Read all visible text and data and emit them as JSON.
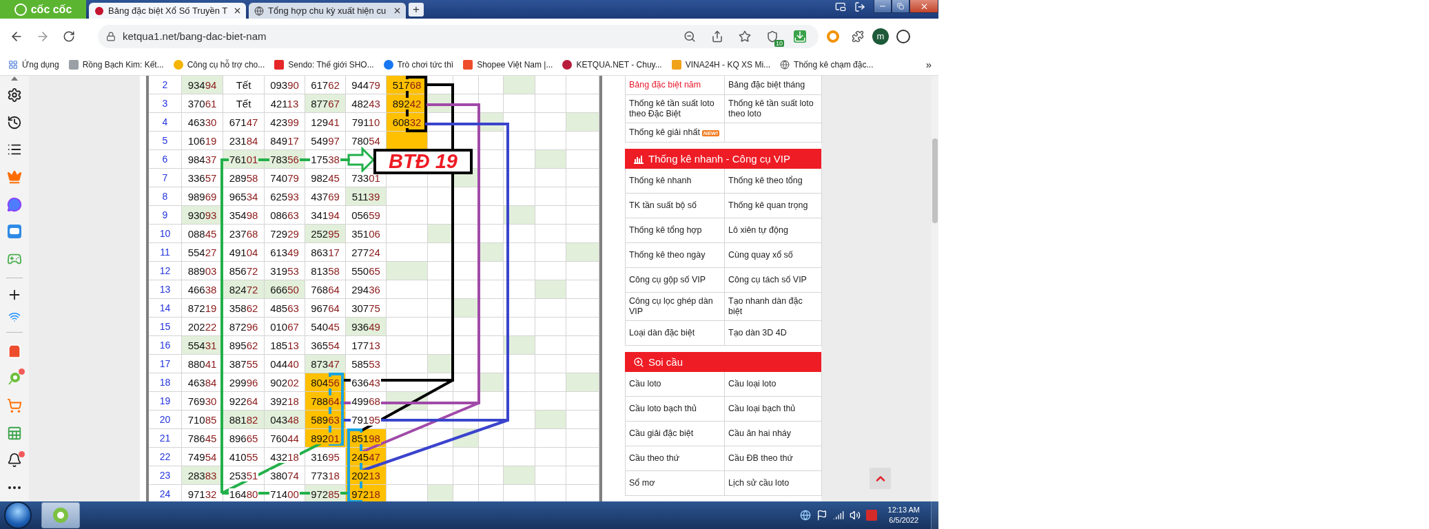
{
  "browser": {
    "logo": "cốc cốc",
    "tabs": [
      {
        "title": "Bảng đặc biệt Xổ Số Truyền T",
        "selected": true
      },
      {
        "title": "Tổng hợp chu kỳ xuất hiện cu",
        "selected": false
      }
    ],
    "new_tab": "+",
    "url": "ketqua1.net/bang-dac-biet-nam",
    "shield_badge": "10",
    "profile_initial": "m",
    "bookmarks": [
      {
        "label": "Ứng dụng",
        "kind": "apps"
      },
      {
        "label": "Rồng Bạch Kim: Kết...",
        "kind": "rbk"
      },
      {
        "label": "Công cụ hỗ trợ cho...",
        "kind": "tool"
      },
      {
        "label": "Sendo: Thế giới SHO...",
        "kind": "sendo"
      },
      {
        "label": "Trò chơi tức thì",
        "kind": "facebook"
      },
      {
        "label": "Shopee Việt Nam |...",
        "kind": "shopee"
      },
      {
        "label": "KETQUA.NET - Chuy...",
        "kind": "ketqua"
      },
      {
        "label": "VINA24H - KQ XS Mi...",
        "kind": "vina"
      },
      {
        "label": "Thống kê chạm đặc...",
        "kind": "globe"
      }
    ],
    "bookmarks_more": "»"
  },
  "side_rail": [
    {
      "kind": "caret",
      "badge": false
    },
    {
      "kind": "settings",
      "badge": false
    },
    {
      "kind": "history",
      "badge": false
    },
    {
      "kind": "list",
      "badge": false
    },
    {
      "kind": "crown",
      "badge": false
    },
    {
      "kind": "messenger",
      "badge": false
    },
    {
      "kind": "zalo",
      "badge": false
    },
    {
      "kind": "gamepad",
      "badge": false
    },
    {
      "kind": "divider"
    },
    {
      "kind": "plus",
      "badge": false
    },
    {
      "kind": "download",
      "badge": false
    },
    {
      "kind": "divider"
    },
    {
      "kind": "shop",
      "badge": false
    },
    {
      "kind": "ball",
      "badge": true
    },
    {
      "kind": "cart",
      "badge": false
    },
    {
      "kind": "sheet",
      "badge": false
    },
    {
      "kind": "bell",
      "badge": true
    },
    {
      "kind": "more",
      "badge": false
    }
  ],
  "table": {
    "rows": [
      {
        "num": "2",
        "cells": [
          {
            "head": "934",
            "tail": "94",
            "color": "#e2efda"
          },
          {
            "head": "Tết"
          },
          {
            "head": "093",
            "tail": "90"
          },
          {
            "head": "617",
            "tail": "62"
          },
          {
            "head": "944",
            "tail": "79"
          },
          {
            "head": "517",
            "tail": "68",
            "color": "#ffc000"
          },
          {},
          {},
          {},
          {
            "color": "#e2efda"
          },
          {},
          {}
        ]
      },
      {
        "num": "3",
        "cells": [
          {
            "head": "370",
            "tail": "61"
          },
          {
            "head": "Tết"
          },
          {
            "head": "421",
            "tail": "13"
          },
          {
            "head": "877",
            "tail": "67",
            "color": "#e2efda"
          },
          {
            "head": "482",
            "tail": "43"
          },
          {
            "head": "892",
            "tail": "42",
            "color": "#ffc000"
          },
          {
            "color": "#e2efda"
          },
          {},
          {},
          {},
          {},
          {}
        ]
      },
      {
        "num": "4",
        "cells": [
          {
            "head": "463",
            "tail": "30"
          },
          {
            "head": "671",
            "tail": "47"
          },
          {
            "head": "423",
            "tail": "99"
          },
          {
            "head": "129",
            "tail": "41"
          },
          {
            "head": "791",
            "tail": "10"
          },
          {
            "head": "608",
            "tail": "32",
            "color": "#ffc000"
          },
          {},
          {},
          {
            "color": "#e2efda"
          },
          {},
          {},
          {
            "color": "#e2efda"
          }
        ]
      },
      {
        "num": "5",
        "cells": [
          {
            "head": "106",
            "tail": "19"
          },
          {
            "head": "231",
            "tail": "84"
          },
          {
            "head": "849",
            "tail": "17"
          },
          {
            "head": "549",
            "tail": "97"
          },
          {
            "head": "780",
            "tail": "54"
          },
          {
            "color": "#ffc000"
          },
          {},
          {},
          {},
          {},
          {},
          {}
        ]
      },
      {
        "num": "6",
        "cells": [
          {
            "head": "984",
            "tail": "37"
          },
          {
            "head": "761",
            "tail": "01",
            "color": "#e2efda"
          },
          {
            "head": "783",
            "tail": "56",
            "color": "#e2efda"
          },
          {
            "head": "175",
            "tail": "38"
          },
          {},
          {},
          {},
          {},
          {},
          {},
          {
            "color": "#e2efda"
          },
          {}
        ]
      },
      {
        "num": "7",
        "cells": [
          {
            "head": "336",
            "tail": "57"
          },
          {
            "head": "289",
            "tail": "58"
          },
          {
            "head": "740",
            "tail": "79"
          },
          {
            "head": "982",
            "tail": "45"
          },
          {
            "head": "733",
            "tail": "01"
          },
          {},
          {},
          {
            "color": "#e2efda"
          },
          {},
          {},
          {},
          {}
        ]
      },
      {
        "num": "8",
        "cells": [
          {
            "head": "989",
            "tail": "69"
          },
          {
            "head": "965",
            "tail": "34"
          },
          {
            "head": "625",
            "tail": "93"
          },
          {
            "head": "437",
            "tail": "69"
          },
          {
            "head": "511",
            "tail": "39",
            "color": "#e2efda"
          },
          {},
          {},
          {},
          {},
          {},
          {},
          {}
        ]
      },
      {
        "num": "9",
        "cells": [
          {
            "head": "930",
            "tail": "93",
            "color": "#e2efda"
          },
          {
            "head": "354",
            "tail": "98"
          },
          {
            "head": "086",
            "tail": "63"
          },
          {
            "head": "341",
            "tail": "94"
          },
          {
            "head": "056",
            "tail": "59"
          },
          {},
          {},
          {},
          {},
          {
            "color": "#e2efda"
          },
          {},
          {}
        ]
      },
      {
        "num": "10",
        "cells": [
          {
            "head": "088",
            "tail": "45"
          },
          {
            "head": "237",
            "tail": "68"
          },
          {
            "head": "729",
            "tail": "29"
          },
          {
            "head": "252",
            "tail": "95",
            "color": "#e2efda"
          },
          {
            "head": "351",
            "tail": "06"
          },
          {},
          {
            "color": "#e2efda"
          },
          {},
          {},
          {},
          {},
          {}
        ]
      },
      {
        "num": "11",
        "cells": [
          {
            "head": "554",
            "tail": "27"
          },
          {
            "head": "491",
            "tail": "04"
          },
          {
            "head": "613",
            "tail": "49"
          },
          {
            "head": "863",
            "tail": "17"
          },
          {
            "head": "277",
            "tail": "24"
          },
          {},
          {},
          {},
          {
            "color": "#e2efda"
          },
          {},
          {},
          {
            "color": "#e2efda"
          }
        ]
      },
      {
        "num": "12",
        "cells": [
          {
            "head": "889",
            "tail": "03"
          },
          {
            "head": "856",
            "tail": "72"
          },
          {
            "head": "319",
            "tail": "53"
          },
          {
            "head": "813",
            "tail": "58"
          },
          {
            "head": "550",
            "tail": "65"
          },
          {
            "color": "#e2efda"
          },
          {},
          {},
          {},
          {},
          {},
          {}
        ]
      },
      {
        "num": "13",
        "cells": [
          {
            "head": "466",
            "tail": "38"
          },
          {
            "head": "824",
            "tail": "72",
            "color": "#e2efda"
          },
          {
            "head": "666",
            "tail": "50",
            "color": "#e2efda"
          },
          {
            "head": "768",
            "tail": "64"
          },
          {
            "head": "294",
            "tail": "36"
          },
          {},
          {},
          {},
          {},
          {},
          {
            "color": "#e2efda"
          },
          {}
        ]
      },
      {
        "num": "14",
        "cells": [
          {
            "head": "872",
            "tail": "19"
          },
          {
            "head": "358",
            "tail": "62"
          },
          {
            "head": "485",
            "tail": "63"
          },
          {
            "head": "967",
            "tail": "64"
          },
          {
            "head": "307",
            "tail": "75"
          },
          {},
          {},
          {
            "color": "#e2efda"
          },
          {},
          {},
          {},
          {}
        ]
      },
      {
        "num": "15",
        "cells": [
          {
            "head": "202",
            "tail": "22"
          },
          {
            "head": "872",
            "tail": "96"
          },
          {
            "head": "010",
            "tail": "67"
          },
          {
            "head": "540",
            "tail": "45"
          },
          {
            "head": "936",
            "tail": "49",
            "color": "#e2efda"
          },
          {},
          {},
          {},
          {},
          {},
          {},
          {}
        ]
      },
      {
        "num": "16",
        "cells": [
          {
            "head": "554",
            "tail": "31",
            "color": "#e2efda"
          },
          {
            "head": "895",
            "tail": "62"
          },
          {
            "head": "185",
            "tail": "13"
          },
          {
            "head": "365",
            "tail": "54"
          },
          {
            "head": "177",
            "tail": "13"
          },
          {},
          {},
          {},
          {},
          {
            "color": "#e2efda"
          },
          {},
          {}
        ]
      },
      {
        "num": "17",
        "cells": [
          {
            "head": "880",
            "tail": "41"
          },
          {
            "head": "387",
            "tail": "55"
          },
          {
            "head": "044",
            "tail": "40"
          },
          {
            "head": "873",
            "tail": "47",
            "color": "#e2efda"
          },
          {
            "head": "585",
            "tail": "53"
          },
          {},
          {
            "color": "#e2efda"
          },
          {},
          {},
          {},
          {},
          {}
        ]
      },
      {
        "num": "18",
        "cells": [
          {
            "head": "463",
            "tail": "84"
          },
          {
            "head": "299",
            "tail": "96"
          },
          {
            "head": "902",
            "tail": "02"
          },
          {
            "head": "804",
            "tail": "56",
            "color": "#ffc000"
          },
          {
            "head": "636",
            "tail": "43"
          },
          {},
          {},
          {},
          {
            "color": "#e2efda"
          },
          {},
          {},
          {
            "color": "#e2efda"
          }
        ]
      },
      {
        "num": "19",
        "cells": [
          {
            "head": "769",
            "tail": "30"
          },
          {
            "head": "922",
            "tail": "64"
          },
          {
            "head": "392",
            "tail": "18"
          },
          {
            "head": "788",
            "tail": "64",
            "color": "#ffc000"
          },
          {
            "head": "499",
            "tail": "68"
          },
          {
            "color": "#e2efda"
          },
          {},
          {},
          {},
          {},
          {},
          {}
        ]
      },
      {
        "num": "20",
        "cells": [
          {
            "head": "710",
            "tail": "85"
          },
          {
            "head": "881",
            "tail": "82",
            "color": "#e2efda"
          },
          {
            "head": "043",
            "tail": "48",
            "color": "#e2efda"
          },
          {
            "head": "589",
            "tail": "63",
            "color": "#ffc000"
          },
          {
            "head": "791",
            "tail": "95"
          },
          {},
          {},
          {},
          {},
          {},
          {
            "color": "#e2efda"
          },
          {}
        ]
      },
      {
        "num": "21",
        "cells": [
          {
            "head": "786",
            "tail": "45"
          },
          {
            "head": "896",
            "tail": "65"
          },
          {
            "head": "760",
            "tail": "44"
          },
          {
            "head": "892",
            "tail": "01",
            "color": "#ffc000"
          },
          {
            "head": "851",
            "tail": "98",
            "color": "#ffc000"
          },
          {},
          {},
          {
            "color": "#e2efda"
          },
          {},
          {},
          {},
          {}
        ]
      },
      {
        "num": "22",
        "cells": [
          {
            "head": "749",
            "tail": "54"
          },
          {
            "head": "410",
            "tail": "55"
          },
          {
            "head": "432",
            "tail": "18"
          },
          {
            "head": "316",
            "tail": "95"
          },
          {
            "head": "245",
            "tail": "47",
            "color": "#ffc000"
          },
          {},
          {},
          {},
          {},
          {},
          {},
          {}
        ]
      },
      {
        "num": "23",
        "cells": [
          {
            "head": "283",
            "tail": "83",
            "color": "#e2efda"
          },
          {
            "head": "253",
            "tail": "51"
          },
          {
            "head": "380",
            "tail": "74"
          },
          {
            "head": "773",
            "tail": "18"
          },
          {
            "head": "202",
            "tail": "13",
            "color": "#ffc000"
          },
          {},
          {},
          {},
          {},
          {
            "color": "#e2efda"
          },
          {},
          {}
        ]
      },
      {
        "num": "24",
        "cells": [
          {
            "head": "971",
            "tail": "32"
          },
          {
            "head": "164",
            "tail": "80"
          },
          {
            "head": "714",
            "tail": "00"
          },
          {
            "head": "972",
            "tail": "85",
            "color": "#e2efda"
          },
          {
            "head": "972",
            "tail": "18",
            "color": "#ffc000"
          },
          {},
          {
            "color": "#e2efda"
          },
          {},
          {},
          {},
          {},
          {}
        ]
      }
    ]
  },
  "annotation": {
    "label": "BTĐ 19"
  },
  "sidebar": [
    {
      "links": [
        {
          "label": "Bảng đặc biệt năm",
          "selected": true
        },
        {
          "label": "Bảng đặc biệt tháng",
          "selected": false
        },
        {
          "label": "Thống kê tần suất loto theo Đặc Biệt",
          "selected": false
        },
        {
          "label": "Thống kê tần suất loto theo loto",
          "selected": false
        },
        {
          "label": "Thống kê giải nhất",
          "selected": false,
          "badge": "NEW!"
        }
      ]
    },
    {
      "title": "Thống kê nhanh - Công cụ VIP",
      "kind": "chart",
      "links": [
        {
          "label": "Thống kê nhanh",
          "selected": false
        },
        {
          "label": "Thống kê theo tổng",
          "selected": false
        },
        {
          "label": "TK tần suất bộ số",
          "selected": false
        },
        {
          "label": "Thống kê quan trọng",
          "selected": false
        },
        {
          "label": "Thống kê tổng hợp",
          "selected": false
        },
        {
          "label": "Lô xiên tự động",
          "selected": false
        },
        {
          "label": "Thống kê theo ngày",
          "selected": false
        },
        {
          "label": "Cùng quay xổ số",
          "selected": false
        },
        {
          "label": "Công cụ gộp số VIP",
          "selected": false
        },
        {
          "label": "Công cụ tách số VIP",
          "selected": false
        },
        {
          "label": "Công cụ lọc ghép dàn VIP",
          "selected": false
        },
        {
          "label": "Tạo nhanh dàn đặc biệt",
          "selected": false
        },
        {
          "label": "Loại dàn đặc biệt",
          "selected": false
        },
        {
          "label": "Tạo dàn 3D 4D",
          "selected": false
        }
      ]
    },
    {
      "title": "Soi cầu",
      "kind": "search",
      "links": [
        {
          "label": "Cầu loto",
          "selected": false
        },
        {
          "label": "Cầu loại loto",
          "selected": false
        },
        {
          "label": "Cầu loto bạch thủ",
          "selected": false
        },
        {
          "label": "Cầu loại bạch thủ",
          "selected": false
        },
        {
          "label": "Cầu giải đặc biệt",
          "selected": false
        },
        {
          "label": "Cầu ăn hai nháy",
          "selected": false
        },
        {
          "label": "Cầu theo thứ",
          "selected": false
        },
        {
          "label": "Cầu ĐB theo thứ",
          "selected": false
        },
        {
          "label": "Sổ mơ",
          "selected": false
        },
        {
          "label": "Lịch sử cầu loto",
          "selected": false
        }
      ]
    }
  ],
  "taskbar": {
    "time": "12:13 AM",
    "date": "6/5/2022"
  }
}
